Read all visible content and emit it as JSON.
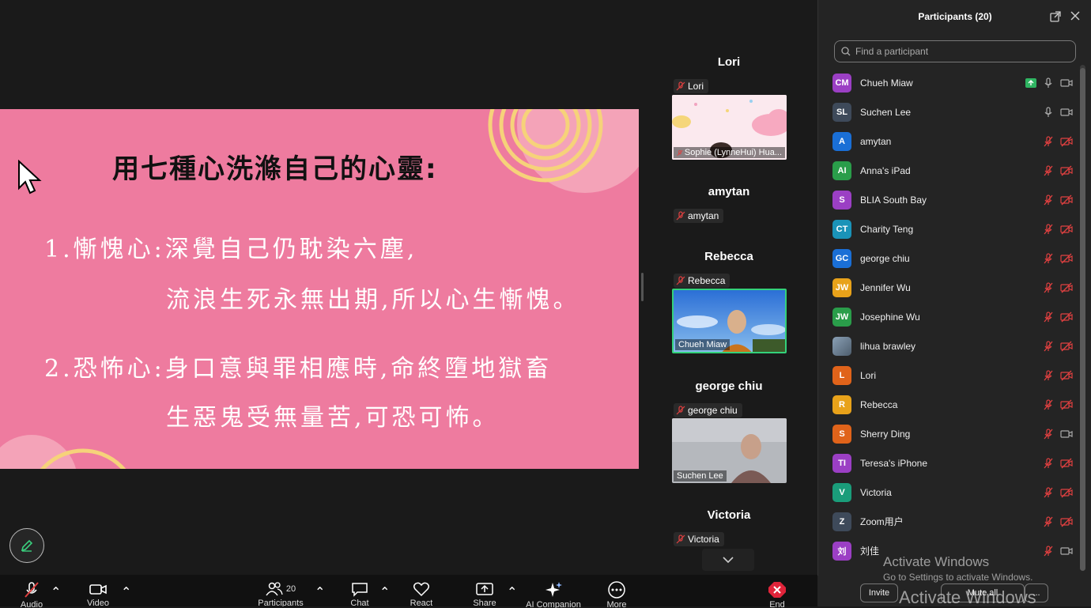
{
  "slide": {
    "title": "用七種心洗滌自己的心靈:",
    "line1": "1.慚愧心:深覺自己仍耽染六塵,",
    "line2": "流浪生死永無出期,所以心生慚愧。",
    "line3": "2.恐怖心:身口意與罪相應時,命終墮地獄畜",
    "line4": "生惡鬼受無量苦,可恐可怖。"
  },
  "gallery": [
    {
      "name": "Lori",
      "tag": "Lori",
      "caption": "Sophie (LynneHui) Hua..."
    },
    {
      "name": "amytan",
      "tag": "amytan"
    },
    {
      "name": "Rebecca",
      "tag": "Rebecca",
      "caption": "Chueh Miaw"
    },
    {
      "name": "george chiu",
      "tag": "george chiu",
      "caption": "Suchen Lee"
    },
    {
      "name": "Victoria",
      "tag": "Victoria"
    }
  ],
  "toolbar": {
    "audio": "Audio",
    "video": "Video",
    "participants": "Participants",
    "participants_count": "20",
    "chat": "Chat",
    "react": "React",
    "share": "Share",
    "ai": "AI Companion",
    "more": "More",
    "end": "End"
  },
  "panel": {
    "title": "Participants (20)",
    "search_placeholder": "Find a participant",
    "invite": "Invite",
    "mute_all": "Mute all",
    "more": "..."
  },
  "participants": [
    {
      "initials": "CM",
      "name": "Chueh Miaw",
      "color": "#9b3fc4",
      "mic": "on",
      "cam": "on",
      "share": true
    },
    {
      "initials": "SL",
      "name": "Suchen Lee",
      "color": "#3e4a5a",
      "mic": "on",
      "cam": "on"
    },
    {
      "initials": "A",
      "name": "amytan",
      "color": "#1a6fd6",
      "mic": "off",
      "cam": "off"
    },
    {
      "initials": "AI",
      "name": "Anna's iPad",
      "color": "#2a9d4a",
      "mic": "off",
      "cam": "off"
    },
    {
      "initials": "S",
      "name": "BLIA South Bay",
      "color": "#9b3fc4",
      "mic": "off",
      "cam": "off"
    },
    {
      "initials": "CT",
      "name": "Charity Teng",
      "color": "#1a93b8",
      "mic": "off",
      "cam": "off"
    },
    {
      "initials": "GC",
      "name": "george chiu",
      "color": "#1a6fd6",
      "mic": "off",
      "cam": "off"
    },
    {
      "initials": "JW",
      "name": "Jennifer Wu",
      "color": "#e8a21a",
      "mic": "off",
      "cam": "off"
    },
    {
      "initials": "JW",
      "name": "Josephine Wu",
      "color": "#2a9d4a",
      "mic": "off",
      "cam": "off"
    },
    {
      "initials": "",
      "name": "lihua brawley",
      "color": "#6d7d8c",
      "mic": "off",
      "cam": "off",
      "photo": true
    },
    {
      "initials": "L",
      "name": "Lori",
      "color": "#e0631a",
      "mic": "off",
      "cam": "off"
    },
    {
      "initials": "R",
      "name": "Rebecca",
      "color": "#e8a21a",
      "mic": "off",
      "cam": "off"
    },
    {
      "initials": "S",
      "name": "Sherry Ding",
      "color": "#e0631a",
      "mic": "off",
      "cam": "on"
    },
    {
      "initials": "TI",
      "name": "Teresa's iPhone",
      "color": "#9b3fc4",
      "mic": "off",
      "cam": "off"
    },
    {
      "initials": "V",
      "name": "Victoria",
      "color": "#1a9d7a",
      "mic": "off",
      "cam": "off"
    },
    {
      "initials": "Z",
      "name": "Zoom用户",
      "color": "#3e4a5a",
      "mic": "off",
      "cam": "off"
    },
    {
      "initials": "刘",
      "name": "刘佳",
      "color": "#9b3fc4",
      "mic": "off",
      "cam": "on"
    }
  ],
  "watermark": {
    "line1": "Activate Windows",
    "line2": "Go to Settings to activate Windows.",
    "line3": "Activate Windows"
  }
}
